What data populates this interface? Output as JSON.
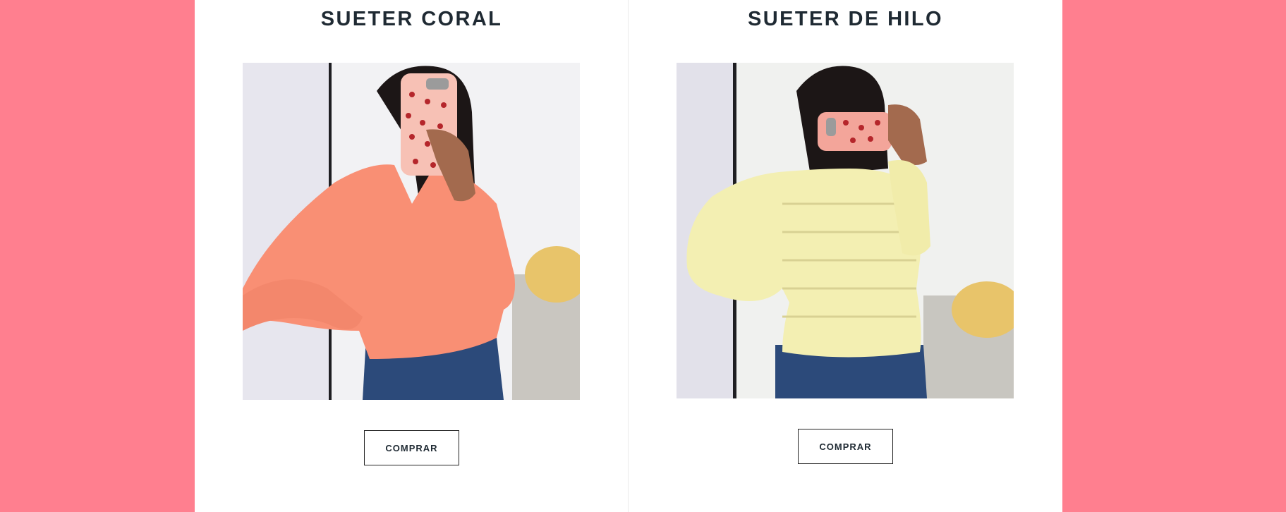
{
  "products": [
    {
      "title": "SUETER CORAL",
      "button_label": "COMPRAR",
      "sweater_color": "#f98f74"
    },
    {
      "title": "SUETER DE HILO",
      "button_label": "COMPRAR",
      "sweater_color": "#f3efb2"
    }
  ],
  "colors": {
    "page_background": "#ff7f8f",
    "panel_background": "#ffffff",
    "title_text": "#1f2a33"
  }
}
